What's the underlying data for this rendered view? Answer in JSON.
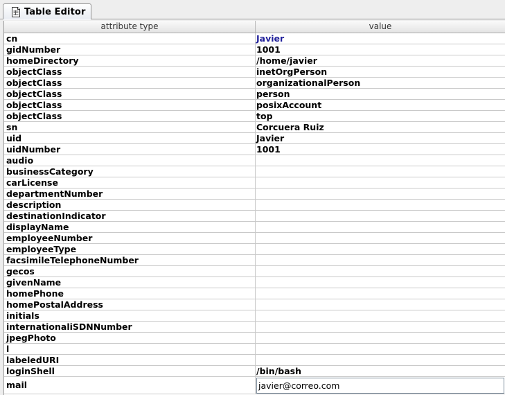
{
  "tab": {
    "label": "Table Editor",
    "icon": "document-table-icon"
  },
  "table": {
    "columns": [
      "attribute type",
      "value"
    ],
    "rows": [
      {
        "attr": "cn",
        "value": "Javier",
        "highlight": true
      },
      {
        "attr": "gidNumber",
        "value": "1001"
      },
      {
        "attr": "homeDirectory",
        "value": "/home/javier"
      },
      {
        "attr": "objectClass",
        "value": "inetOrgPerson"
      },
      {
        "attr": "objectClass",
        "value": "organizationalPerson"
      },
      {
        "attr": "objectClass",
        "value": "person"
      },
      {
        "attr": "objectClass",
        "value": "posixAccount"
      },
      {
        "attr": "objectClass",
        "value": "top"
      },
      {
        "attr": "sn",
        "value": "Corcuera Ruiz"
      },
      {
        "attr": "uid",
        "value": "Javier"
      },
      {
        "attr": "uidNumber",
        "value": "1001"
      },
      {
        "attr": "audio",
        "value": ""
      },
      {
        "attr": "businessCategory",
        "value": ""
      },
      {
        "attr": "carLicense",
        "value": ""
      },
      {
        "attr": "departmentNumber",
        "value": ""
      },
      {
        "attr": "description",
        "value": ""
      },
      {
        "attr": "destinationIndicator",
        "value": ""
      },
      {
        "attr": "displayName",
        "value": ""
      },
      {
        "attr": "employeeNumber",
        "value": ""
      },
      {
        "attr": "employeeType",
        "value": ""
      },
      {
        "attr": "facsimileTelephoneNumber",
        "value": ""
      },
      {
        "attr": "gecos",
        "value": ""
      },
      {
        "attr": "givenName",
        "value": ""
      },
      {
        "attr": "homePhone",
        "value": ""
      },
      {
        "attr": "homePostalAddress",
        "value": ""
      },
      {
        "attr": "initials",
        "value": ""
      },
      {
        "attr": "internationaliSDNNumber",
        "value": ""
      },
      {
        "attr": "jpegPhoto",
        "value": ""
      },
      {
        "attr": "l",
        "value": ""
      },
      {
        "attr": "labeledURI",
        "value": ""
      },
      {
        "attr": "loginShell",
        "value": "/bin/bash"
      },
      {
        "attr": "mail",
        "value": "javier@correo.com",
        "editing": true
      }
    ]
  },
  "colors": {
    "highlight_value": "#1e1e9a",
    "grid": "#c9c9c9"
  }
}
